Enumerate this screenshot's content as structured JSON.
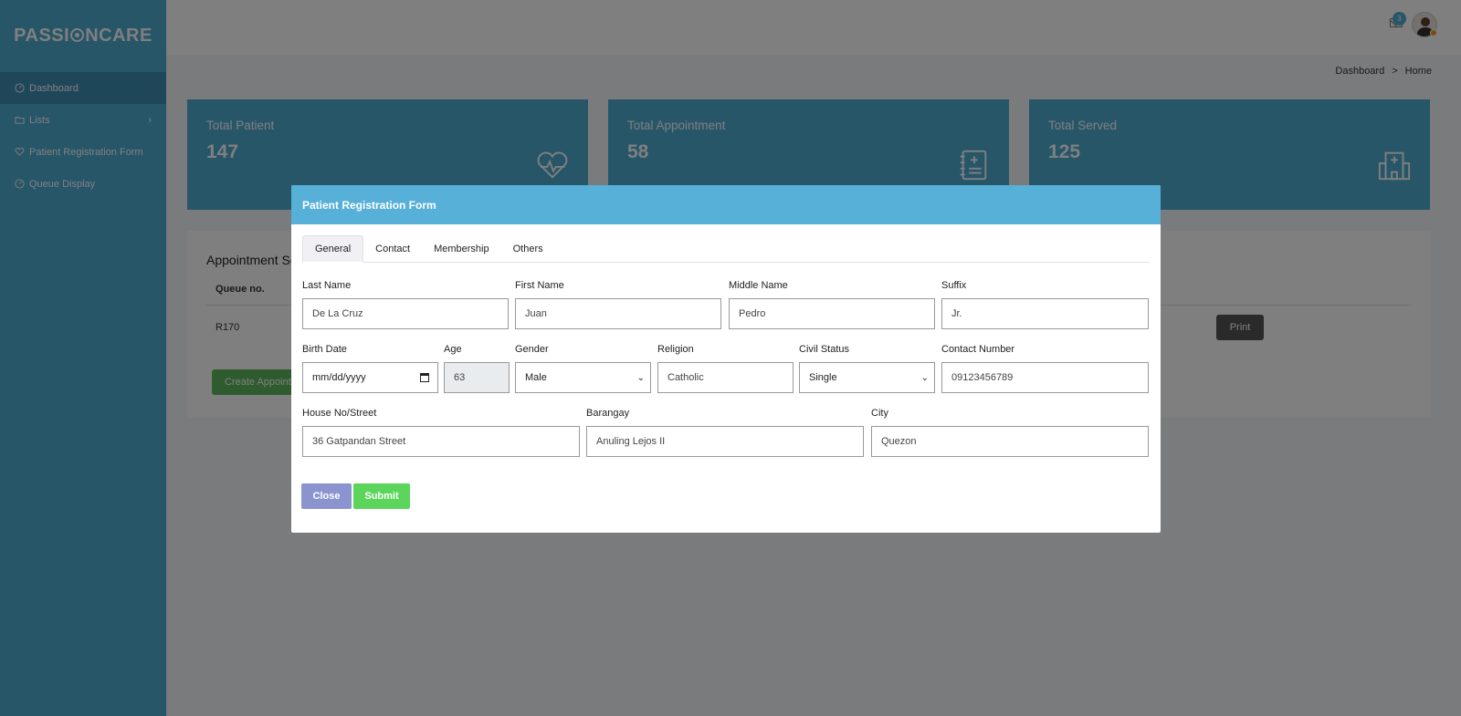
{
  "app": {
    "brand_pre": "PASSI",
    "brand_post": "NCARE"
  },
  "sidebar": {
    "items": [
      {
        "label": "Dashboard",
        "icon": "gauge-icon"
      },
      {
        "label": "Lists",
        "icon": "folder-icon"
      },
      {
        "label": "Patient Registration Form",
        "icon": "heart-icon"
      },
      {
        "label": "Queue Display",
        "icon": "gauge-icon"
      }
    ]
  },
  "topbar": {
    "notification_count": "3"
  },
  "breadcrumb": {
    "parent": "Dashboard",
    "separator": ">",
    "current": "Home"
  },
  "stats": [
    {
      "label": "Total Patient",
      "value": "147",
      "icon": "heartbeat-icon"
    },
    {
      "label": "Total Appointment",
      "value": "58",
      "icon": "notebook-medical-icon"
    },
    {
      "label": "Total Served",
      "value": "125",
      "icon": "hospital-icon"
    }
  ],
  "appointments": {
    "title": "Appointment Se",
    "col_queue": "Queue no.",
    "rows": [
      {
        "queue": "R170",
        "print_label": "Print"
      }
    ],
    "create_label": "Create Appoint"
  },
  "modal": {
    "title": "Patient Registration Form",
    "tabs": [
      "General",
      "Contact",
      "Membership",
      "Others"
    ],
    "active_tab": "General",
    "fields": {
      "last_name": {
        "label": "Last Name",
        "value": "De La Cruz"
      },
      "first_name": {
        "label": "First Name",
        "value": "Juan"
      },
      "middle_name": {
        "label": "Middle Name",
        "value": "Pedro"
      },
      "suffix": {
        "label": "Suffix",
        "value": "Jr."
      },
      "birth_date": {
        "label": "Birth Date",
        "value": "mm/dd/yyyy"
      },
      "age": {
        "label": "Age",
        "value": "63"
      },
      "gender": {
        "label": "Gender",
        "value": "Male"
      },
      "religion": {
        "label": "Religion",
        "value": "Catholic"
      },
      "civil_status": {
        "label": "Civil Status",
        "value": "Single"
      },
      "contact_number": {
        "label": "Contact Number",
        "value": "09123456789"
      },
      "house_street": {
        "label": "House No/Street",
        "value": "36 Gatpandan Street"
      },
      "barangay": {
        "label": "Barangay",
        "value": "Anuling Lejos II"
      },
      "city": {
        "label": "City",
        "value": "Quezon"
      }
    },
    "close_label": "Close",
    "submit_label": "Submit"
  },
  "colors": {
    "accent": "#4fadd3",
    "modal_header": "#56b0d7",
    "close_button": "#8b94cf",
    "submit_button": "#5cd55c"
  }
}
